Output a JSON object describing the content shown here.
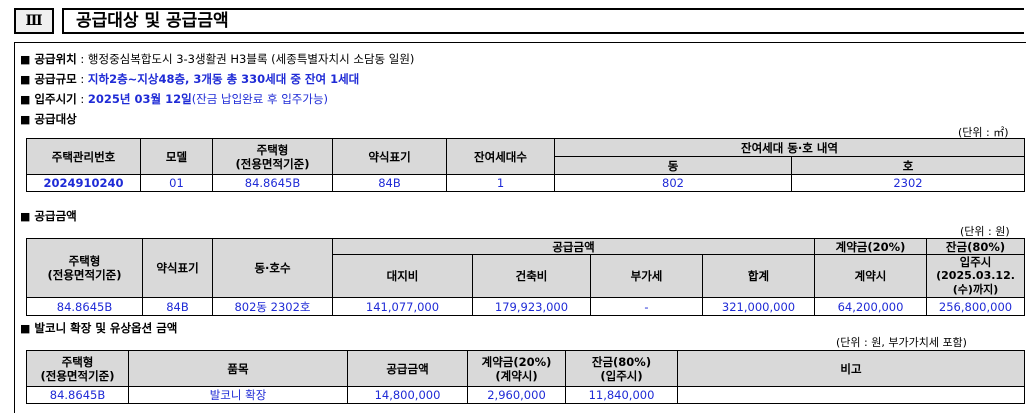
{
  "section": {
    "number": "Ⅲ",
    "title": "공급대상 및 공급금액"
  },
  "info": {
    "location_label": "공급위치",
    "location_value": "행정중심복합도시 3-3생활권 H3블록 (세종특별자치시 소담동 일원)",
    "scale_label": "공급규모",
    "scale_value": "지하2층~지상48층, 3개동 총 330세대 중 잔여 1세대",
    "movein_label": "입주시기",
    "movein_value": "2025년 03월 12일",
    "movein_note": "(잔금 납입완료 후 입주가능)",
    "target_label": "공급대상",
    "price_label": "공급금액",
    "balcony_label": "발코니 확장 및 유상옵션 금액"
  },
  "bullet": "■",
  "colon": ":",
  "units": {
    "target": "(단위 : ㎡)",
    "price": "(단위 : 원)",
    "balcony": "(단위 : 원, 부가가치세 포함)"
  },
  "target_table": {
    "headers": {
      "mgmt_no": "주택관리번호",
      "model": "모델",
      "type_line1": "주택형",
      "type_line2": "(전용면적기준)",
      "abbr": "약식표기",
      "remaining": "잔여세대수",
      "detail": "잔여세대 동·호 내역",
      "dong": "동",
      "ho": "호"
    },
    "row": {
      "mgmt_no": "2024910240",
      "model": "01",
      "type": "84.8645B",
      "abbr": "84B",
      "remaining": "1",
      "dong": "802",
      "ho": "2302"
    }
  },
  "price_table": {
    "headers": {
      "type_line1": "주택형",
      "type_line2": "(전용면적기준)",
      "abbr": "약식표기",
      "unit": "동·호수",
      "supply": "공급금액",
      "land": "대지비",
      "building": "건축비",
      "vat": "부가세",
      "total": "합계",
      "deposit": "계약금(20%)",
      "deposit_sub": "계약시",
      "balance": "잔금(80%)",
      "balance_sub": "입주시",
      "balance_date": "(2025.03.12.(수)까지)"
    },
    "row": {
      "type": "84.8645B",
      "abbr": "84B",
      "unit": "802동 2302호",
      "land": "141,077,000",
      "building": "179,923,000",
      "vat": "-",
      "total": "321,000,000",
      "deposit": "64,200,000",
      "balance": "256,800,000"
    }
  },
  "balcony_table": {
    "headers": {
      "type_line1": "주택형",
      "type_line2": "(전용면적기준)",
      "item": "품목",
      "supply": "공급금액",
      "deposit_line1": "계약금(20%)",
      "deposit_line2": "(계약시)",
      "balance_line1": "잔금(80%)",
      "balance_line2": "(입주시)",
      "remark": "비고"
    },
    "row": {
      "type": "84.8645B",
      "item": "발코니 확장",
      "supply": "14,800,000",
      "deposit": "2,960,000",
      "balance": "11,840,000",
      "remark": ""
    }
  }
}
